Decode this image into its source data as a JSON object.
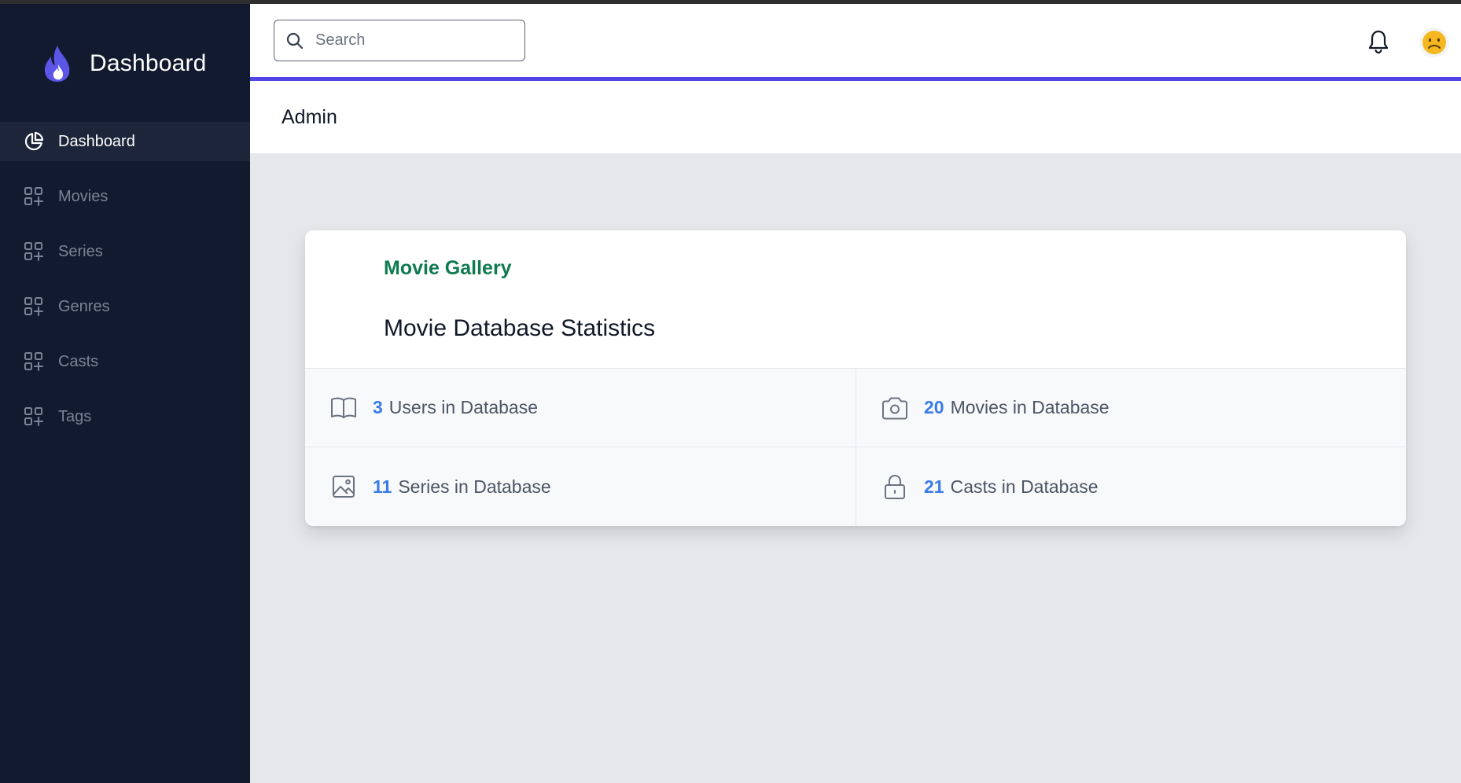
{
  "sidebar": {
    "brand": "Dashboard",
    "items": [
      {
        "label": "Dashboard",
        "icon": "pie-chart-icon",
        "active": true
      },
      {
        "label": "Movies",
        "icon": "grid-plus-icon"
      },
      {
        "label": "Series",
        "icon": "grid-plus-icon"
      },
      {
        "label": "Genres",
        "icon": "grid-plus-icon"
      },
      {
        "label": "Casts",
        "icon": "grid-plus-icon"
      },
      {
        "label": "Tags",
        "icon": "grid-plus-icon"
      }
    ]
  },
  "topbar": {
    "search_placeholder": "Search",
    "notification_icon": "bell-icon",
    "avatar_icon": "frowning-face-icon"
  },
  "header": {
    "title": "Admin"
  },
  "card": {
    "kicker": "Movie Gallery",
    "title": "Movie Database Statistics",
    "stats": [
      {
        "value": "3",
        "label": "Users in Database",
        "icon": "book-open-icon"
      },
      {
        "value": "20",
        "label": "Movies in Database",
        "icon": "camera-icon"
      },
      {
        "value": "11",
        "label": "Series in Database",
        "icon": "image-icon"
      },
      {
        "value": "21",
        "label": "Casts in Database",
        "icon": "lock-icon"
      }
    ]
  },
  "colors": {
    "sidebar_bg": "#111a2e",
    "accent": "#4f46e5",
    "kicker": "#0f7a4f",
    "stat_number": "#3b7be8"
  }
}
